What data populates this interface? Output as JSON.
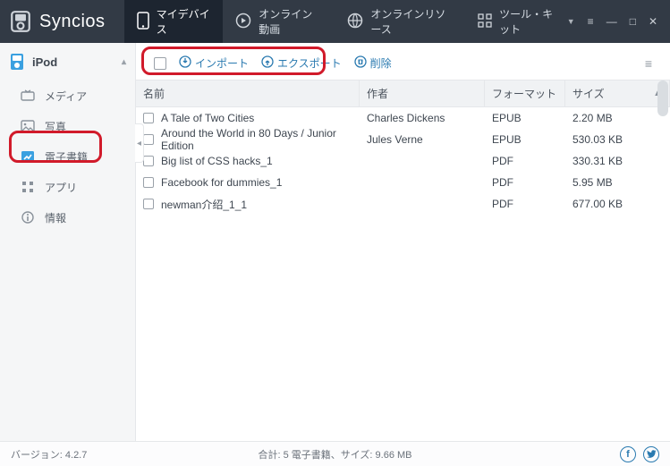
{
  "app": {
    "name": "Syncios"
  },
  "nav": {
    "items": [
      {
        "label": "マイデバイス",
        "active": true
      },
      {
        "label": "オンライン動画",
        "active": false
      },
      {
        "label": "オンラインリソース",
        "active": false
      },
      {
        "label": "ツール・キット",
        "active": false
      }
    ]
  },
  "sidebar": {
    "device": "iPod",
    "items": [
      {
        "label": "メディア"
      },
      {
        "label": "写真"
      },
      {
        "label": "電子書籍"
      },
      {
        "label": "アプリ"
      },
      {
        "label": "情報"
      }
    ],
    "selected_index": 2
  },
  "toolbar": {
    "import_label": "インポート",
    "export_label": "エクスポート",
    "delete_label": "削除"
  },
  "table": {
    "headers": {
      "name": "名前",
      "author": "作者",
      "format": "フォーマット",
      "size": "サイズ"
    },
    "rows": [
      {
        "name": "A Tale of Two Cities",
        "author": "Charles Dickens",
        "format": "EPUB",
        "size": "2.20 MB"
      },
      {
        "name": "Around the World in 80 Days / Junior Edition",
        "author": "Jules Verne",
        "format": "EPUB",
        "size": "530.03 KB"
      },
      {
        "name": "Big list of CSS hacks_1",
        "author": "",
        "format": "PDF",
        "size": "330.31 KB"
      },
      {
        "name": "Facebook for dummies_1",
        "author": "",
        "format": "PDF",
        "size": "5.95 MB"
      },
      {
        "name": "newman介绍_1_1",
        "author": "",
        "format": "PDF",
        "size": "677.00 KB"
      }
    ]
  },
  "status": {
    "version_label": "バージョン: 4.2.7",
    "summary": "合計: 5 電子書籍、サイズ: 9.66 MB"
  }
}
